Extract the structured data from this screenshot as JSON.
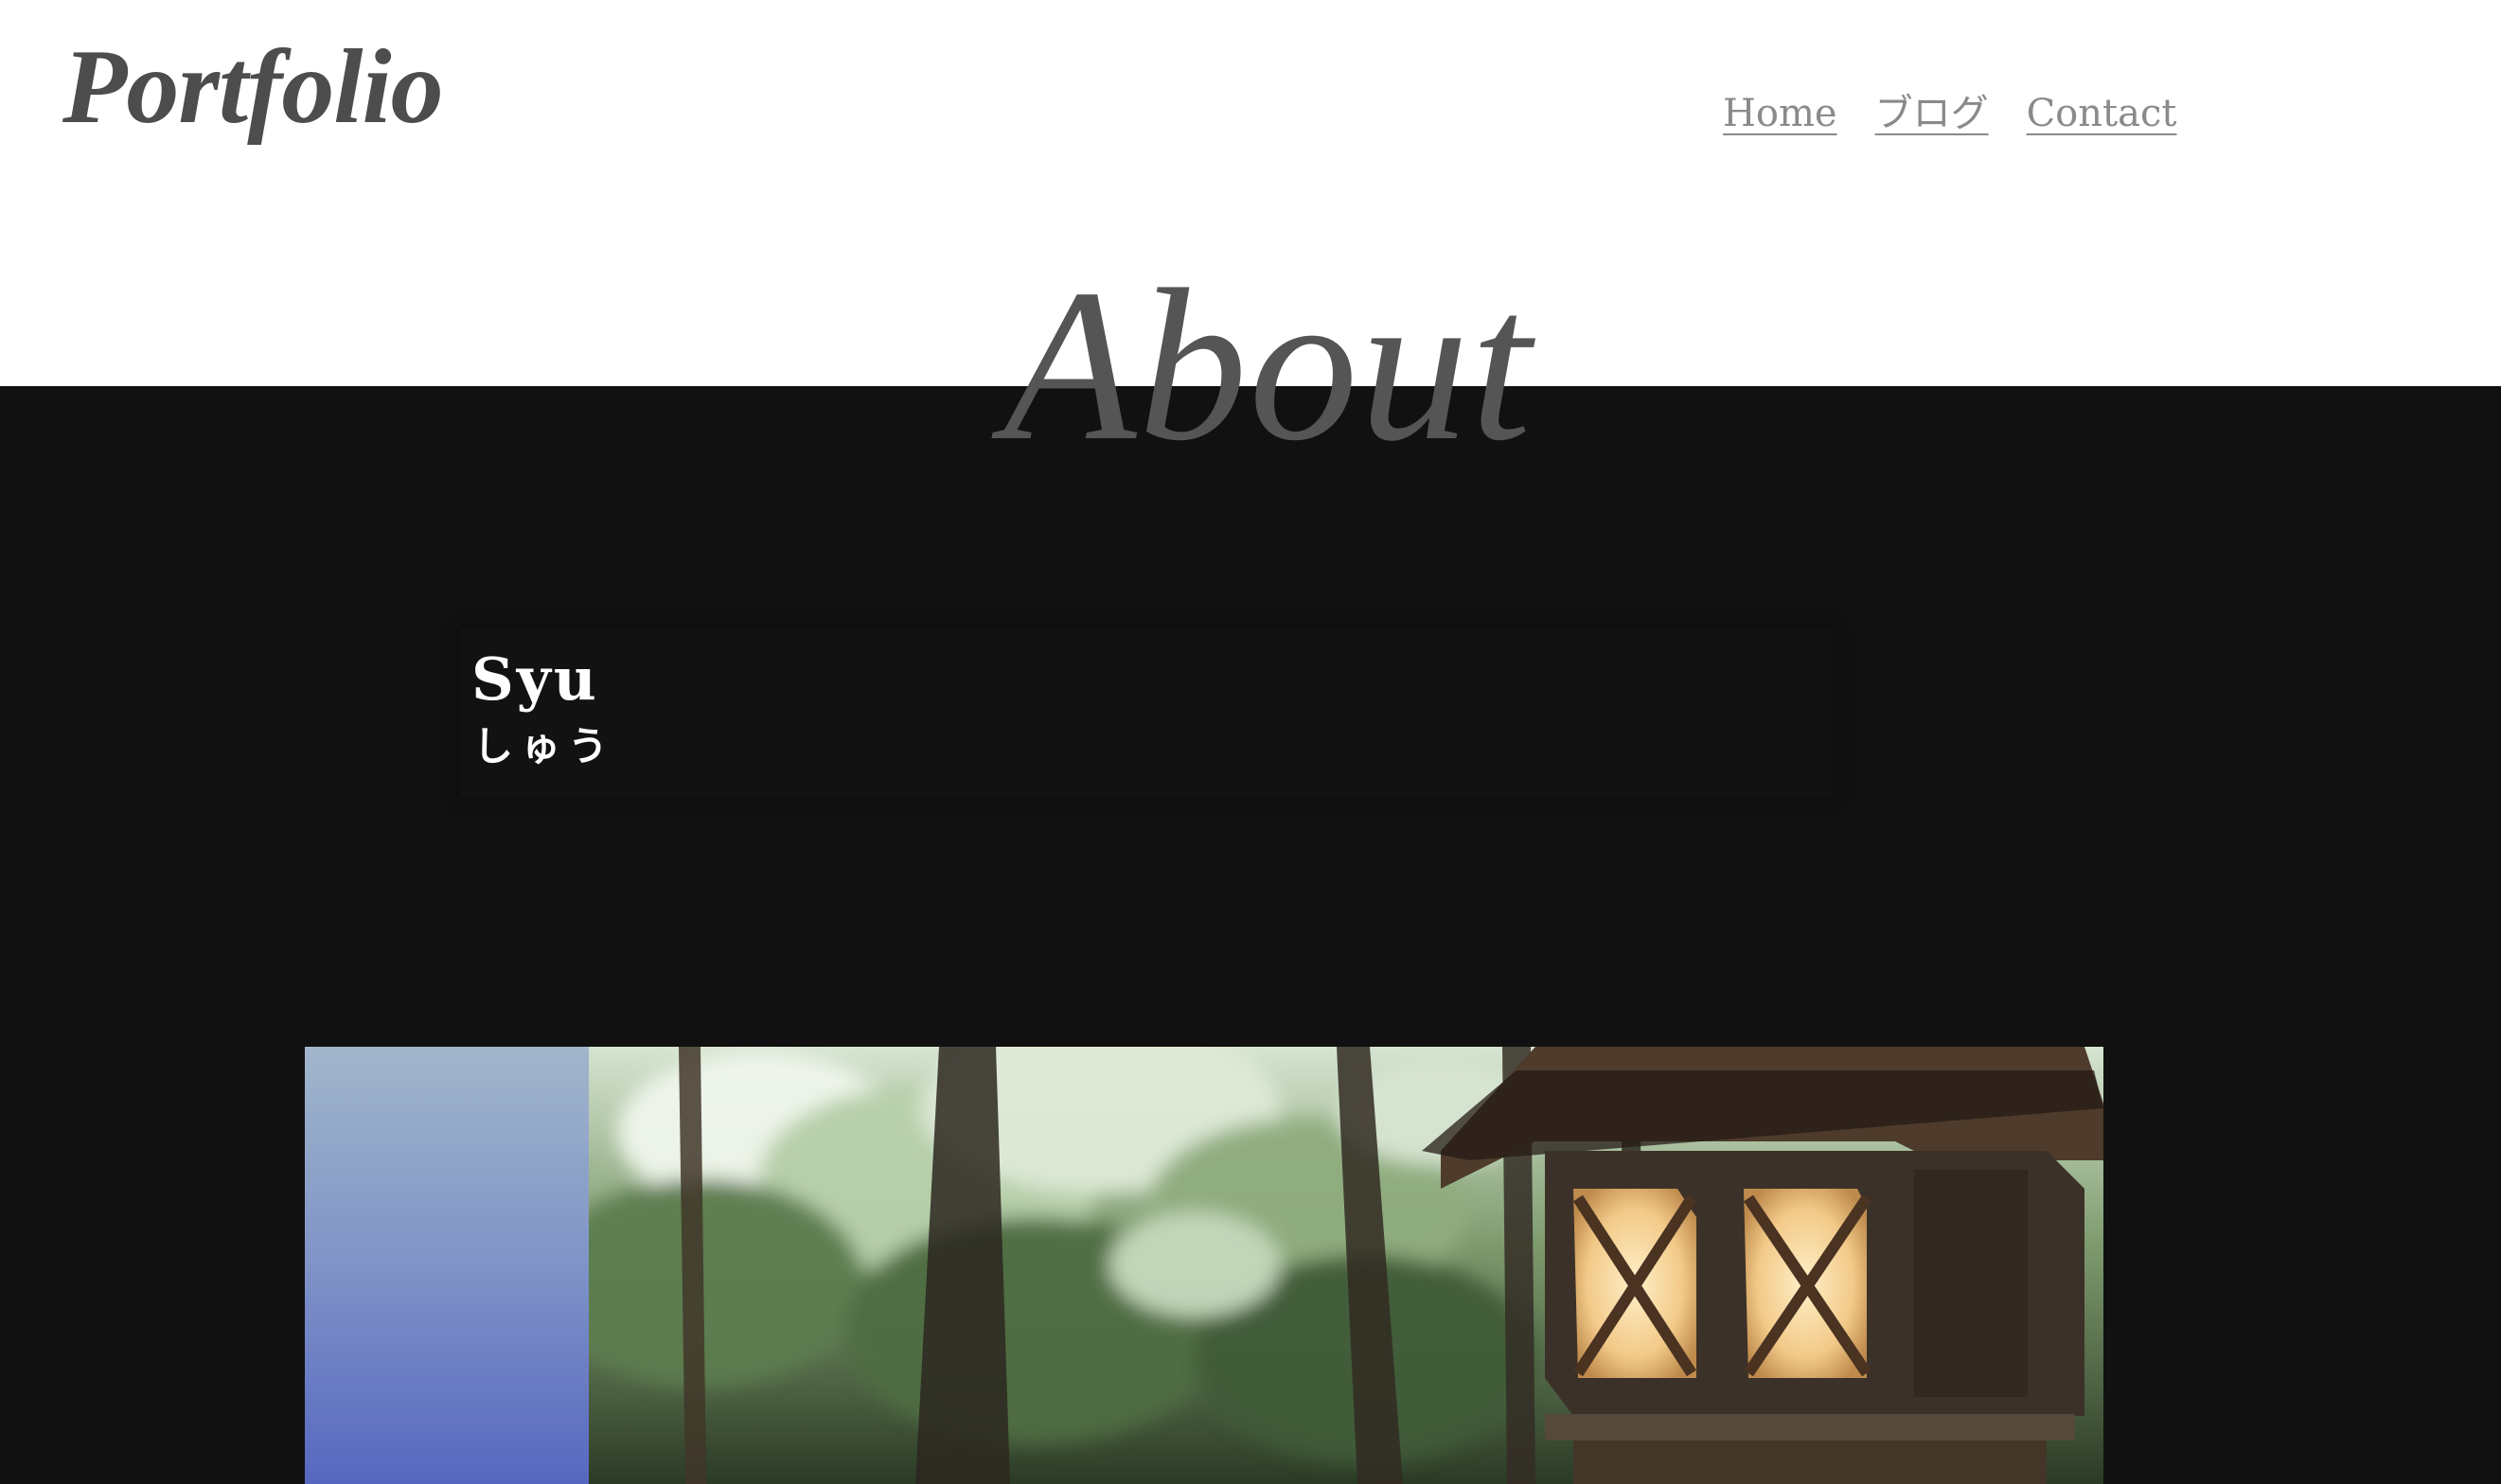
{
  "header": {
    "logo": "Portfolio",
    "nav": [
      {
        "label": "Home"
      },
      {
        "label": "ブログ"
      },
      {
        "label": "Contact"
      }
    ]
  },
  "about": {
    "heading": "About",
    "name": "Syu",
    "name_kana": "しゅう"
  },
  "colors": {
    "header_background": "#ffffff",
    "section_background": "#111111",
    "logo_text": "#4d4d4d",
    "nav_link": "#8a8a8a",
    "profile_text": "#ffffff",
    "gradient_top": "#a1b6cb",
    "gradient_bottom": "#5767c0"
  },
  "media": {
    "photo_subject": "stone-lantern-forest-photo",
    "left_panel": "blue-gradient-panel"
  }
}
